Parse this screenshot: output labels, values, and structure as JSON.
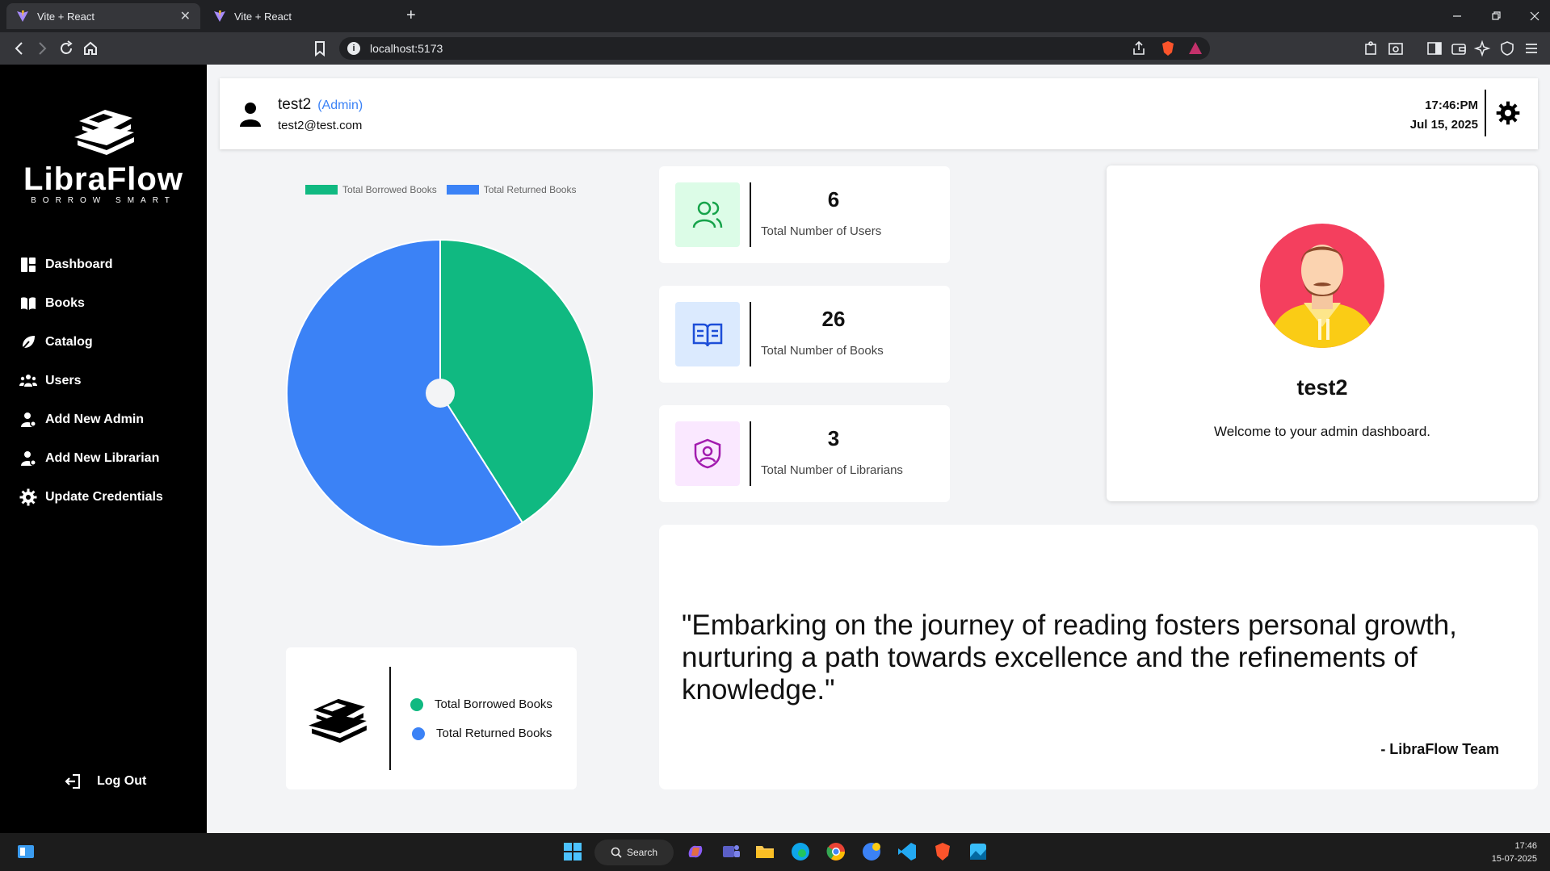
{
  "browser": {
    "tabs": [
      {
        "title": "Vite + React",
        "close": "✕"
      },
      {
        "title": "Vite + React"
      }
    ],
    "new_tab": "+",
    "url": "localhost:5173",
    "info_glyph": "i"
  },
  "sidebar": {
    "logo_name": "LibraFlow",
    "logo_tagline": "BORROW SMART",
    "items": [
      {
        "label": "Dashboard",
        "icon": "dashboard-icon"
      },
      {
        "label": "Books",
        "icon": "book-icon"
      },
      {
        "label": "Catalog",
        "icon": "catalog-icon"
      },
      {
        "label": "Users",
        "icon": "users-icon"
      },
      {
        "label": "Add New Admin",
        "icon": "add-admin-icon"
      },
      {
        "label": "Add New Librarian",
        "icon": "add-librarian-icon"
      },
      {
        "label": "Update Credentials",
        "icon": "gear-icon"
      }
    ],
    "logout": "Log Out"
  },
  "header": {
    "user_name": "test2",
    "user_role": "(Admin)",
    "user_email": "test2@test.com",
    "time": "17:46:PM",
    "date": "Jul 15, 2025"
  },
  "chart_data": {
    "type": "pie",
    "categories": [
      "Total Borrowed Books",
      "Total Returned Books"
    ],
    "values": [
      41,
      59
    ],
    "colors": [
      "#10b981",
      "#3b82f6"
    ],
    "legend": "top"
  },
  "legend_card": {
    "items": [
      {
        "label": "Total Borrowed Books",
        "color": "#10b981"
      },
      {
        "label": "Total Returned Books",
        "color": "#3b82f6"
      }
    ]
  },
  "stats": [
    {
      "value": "6",
      "label": "Total Number of Users",
      "icon": "users-icon",
      "bg": "#dcfce7",
      "color": "#16a34a"
    },
    {
      "value": "26",
      "label": "Total Number of Books",
      "icon": "open-book-icon",
      "bg": "#dbeafe",
      "color": "#1d4ed8"
    },
    {
      "value": "3",
      "label": "Total Number of Librarians",
      "icon": "shield-user-icon",
      "bg": "#fae8ff",
      "color": "#a21caf"
    }
  ],
  "profile": {
    "name": "test2",
    "welcome": "Welcome to your admin dashboard."
  },
  "quote": {
    "text": "\"Embarking on the journey of reading fosters personal growth, nurturing a path towards excellence and the refinements of knowledge.\"",
    "author": "- LibraFlow Team"
  },
  "taskbar": {
    "search": "Search",
    "time": "17:46",
    "date": "15-07-2025"
  }
}
